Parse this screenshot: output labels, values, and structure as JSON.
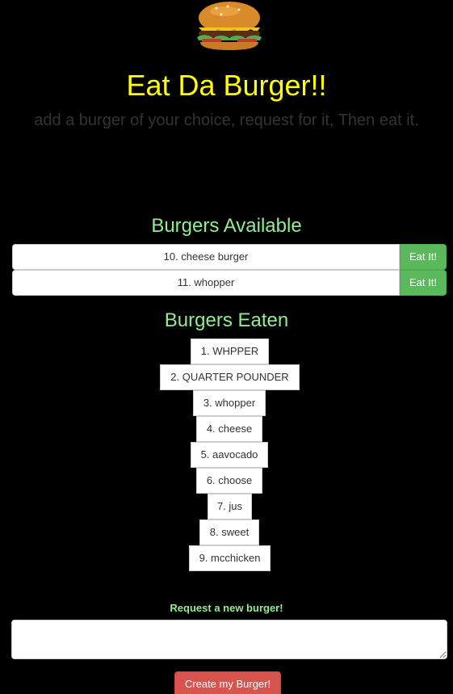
{
  "header": {
    "title": "Eat Da Burger!!",
    "subtitle": "add a burger of your choice, request for it, Then eat it.",
    "logo_icon": "burger-icon"
  },
  "colors": {
    "title": "#ffff00",
    "subtitle": "#333333",
    "section_heading": "#90ee90",
    "eat_button": "#5cb85c",
    "create_button": "#d9534f"
  },
  "available": {
    "heading": "Burgers Available",
    "items": [
      {
        "name": "10. cheese burger",
        "button_label": "Eat It!"
      },
      {
        "name": "11. whopper",
        "button_label": "Eat It!"
      }
    ]
  },
  "eaten": {
    "heading": "Burgers Eaten",
    "items": [
      "1. WHPPER",
      "2. QUARTER POUNDER",
      "3. whopper",
      "4. cheese",
      "5. aavocado",
      "6. choose",
      "7. jus",
      "8. sweet",
      "9. mcchicken"
    ]
  },
  "request": {
    "label": "Request a new burger!",
    "textarea_value": "",
    "placeholder": "",
    "button_label": "Create my Burger!"
  }
}
